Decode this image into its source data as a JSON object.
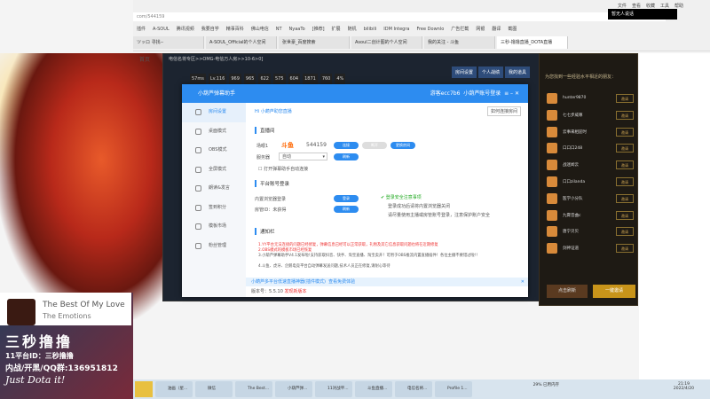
{
  "browser": {
    "menu": [
      "文件",
      "查看",
      "收藏",
      "工具",
      "帮助"
    ],
    "address": "com/544159",
    "bookmarks": [
      "插件",
      "A-SOUL",
      "腾讯视频",
      "我要自学",
      "精事百科",
      "佛山电信",
      "NT",
      "NyaaTo",
      "[推荐]",
      "扩展",
      "随机",
      "bilibili",
      "IDM Integra",
      "Free Downlo",
      "广告拦截",
      "网银",
      "翻译",
      "截图"
    ],
    "tabs": [
      "ツッロ 寻找--",
      "A-SOUL_Official的个人空间",
      "张世豪_百度搜索",
      "Asoul二创计图的个人空间",
      "我的关注 - 斗鱼",
      "三秒-撸撸直播_DOTA直播"
    ],
    "toast": "暂无人说话",
    "home": "首页"
  },
  "game": {
    "breadcrumb": "电信名将专区>>OMG-电信万人房>>10-6>0]",
    "stats": [
      "57ms",
      "Lv.116",
      "969",
      "965",
      "622",
      "575",
      "604",
      "1871",
      "760",
      "4%"
    ],
    "tabs": [
      "房间设置",
      "个人战绩",
      "我的道具"
    ]
  },
  "dialog": {
    "title": "小葫芦弹幕助手",
    "account": "游客ecc7b6",
    "login": "小葫芦账号登录",
    "sidebar": [
      "房间设置",
      "桌面模式",
      "OBS模式",
      "全屏模式",
      "朗读&发言",
      "签到积分",
      "模板市场",
      "粉丝管理"
    ],
    "header": "Hi 小葫芦助您直播",
    "help": "如何连接房间",
    "room": {
      "section": "直播间",
      "label": "场眼1",
      "platform": "斗鱼",
      "id": "544159",
      "connect": "连接",
      "disconnect": "断开",
      "change": "更换房间",
      "server_label": "服务器",
      "server_value": "自动",
      "refresh": "刷新",
      "auto": "打开弹幕助手自动连接"
    },
    "platform": {
      "section": "平台账号登录",
      "browser_login": "内置浏览器登录",
      "login_btn": "登录",
      "room_mgr": "房管ID：未获得",
      "refresh": "刷新",
      "tips_title": "登录安全注意事项",
      "tips": [
        "登录成功后请将内置浏览器关闭",
        "请尽量使用主播或房管账号登录，注意保护账户安全"
      ]
    },
    "notice": {
      "section": "通知栏",
      "items": [
        "1.YY平台无法连接的问题已经修复，弹幕信息已经可以正常获取，礼物及其它信息获取问题也将在近期修复",
        "2.OBS模式的模板市场已经恢复",
        "3.小葫芦弹幕助手V4.1发布啦!支持获取抖音、快手、淘宝直播、淘宝卖开！可用于OBS推流内置直播插件！各位主播不要错过啦!!",
        "4.斗鱼、虎牙、企鹅电竞平台自动弹幕发送问题,技术人员正在修复,请耐心等待"
      ]
    },
    "banner": "小葫芦多平台低速直播神器(插件模式)",
    "banner_link": "查看免费体验",
    "version": "版本号：5.5.10",
    "update": "发现新版本"
  },
  "overlay": {
    "song": "The Best Of My Love",
    "artist": "The Emotions",
    "name": "三秒撸撸",
    "room_id": "11平台ID：三秒撸撸",
    "qq": "内战/开黑/QQ群:136951812",
    "slogan": "Just Dota it!"
  },
  "friends": {
    "title": "为您找到一些经验水平相近的朋友：",
    "invite": "邀请",
    "list": [
      "hunter9870",
      "七七步威尊",
      "云事来相迎时",
      "口口口248",
      "战迷闻云",
      "口口zilanda",
      "医学小分队",
      "九霄音曲c",
      "唐宁贝贝",
      "剑神证道"
    ],
    "refresh": "点击刷新",
    "invite_all": "一键邀请"
  },
  "taskbar": {
    "apps": [
      "油画（星...",
      "微信",
      "The Best...",
      "小葫芦弹...",
      "11对战平...",
      "斗鱼直播...",
      "电信名将...",
      "Profile 1..."
    ],
    "battery": "29% 已用内存",
    "time": "21:19",
    "date": "2022/4/20"
  }
}
